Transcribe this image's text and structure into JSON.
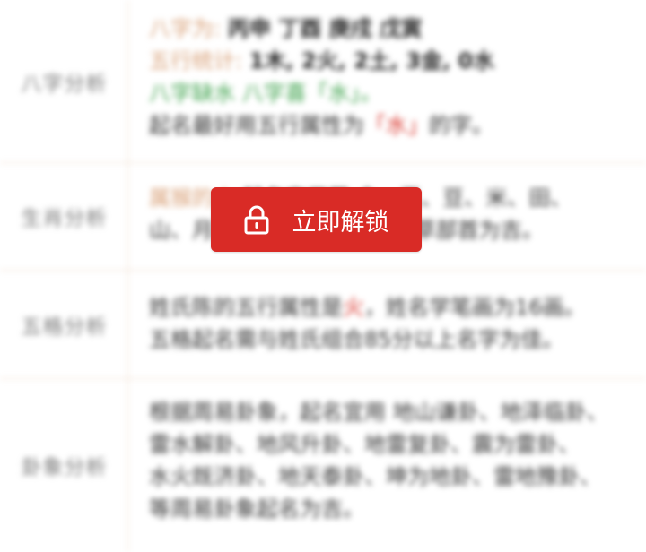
{
  "rows": [
    {
      "label": "八字分析",
      "lines": [
        {
          "a": "八字为:",
          "b": "丙申 丁酉 庚戌 戊寅"
        },
        {
          "a": "五行统计:",
          "b": "1木, 2火, 2土, 3金, 0水"
        },
        {
          "green": "八字缺水 八字喜「水」。"
        },
        {
          "pre": "起名最好用五行属性为",
          "red": "「水」",
          "post": "的字。"
        }
      ]
    },
    {
      "label": "生肖分析",
      "lines": [
        {
          "a": "属猴的人",
          "b": "起名宜用带 金、玉、豆、米、田、"
        },
        {
          "text": "山、月、水 等字根的字，以草部首为吉。"
        }
      ]
    },
    {
      "label": "五格分析",
      "lines": [
        {
          "pre": "姓氏陈的五行属性是",
          "red": "火",
          "post": "，姓名学笔画为16画。"
        },
        {
          "text": "五格起名需与姓氏组合85分以上名字为佳。"
        }
      ]
    },
    {
      "label": "卦象分析",
      "lines": [
        {
          "text": "根据周易卦象，起名宜用 地山谦卦、地泽临卦、"
        },
        {
          "text": "雷水解卦、地风升卦、地雷复卦、震为雷卦、"
        },
        {
          "text": "水火既济卦、地天泰卦、坤为地卦、雷地豫卦、"
        },
        {
          "text": "等周易卦象起名为吉。"
        }
      ]
    }
  ],
  "unlock_button": {
    "label": "立即解锁",
    "icon": "lock-icon"
  },
  "colors": {
    "accent": "#d92b26",
    "orange": "#d9a27a",
    "green": "#3fa34d",
    "border": "#efd9c8"
  }
}
